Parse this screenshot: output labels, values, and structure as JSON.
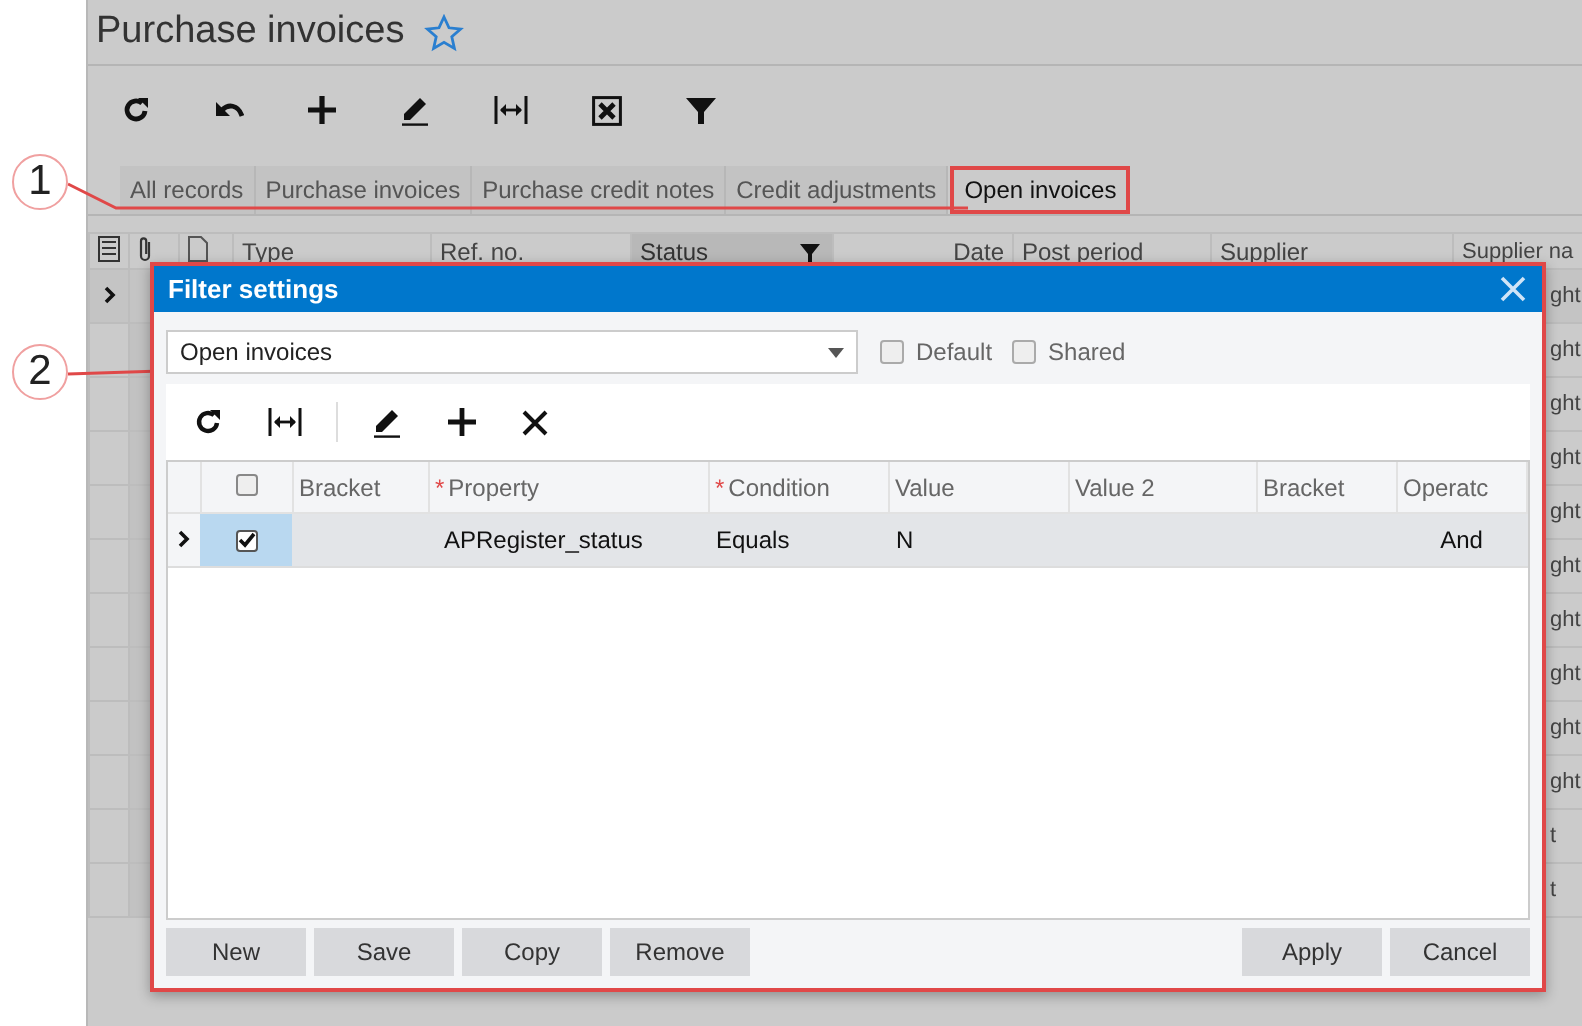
{
  "page": {
    "title": "Purchase invoices"
  },
  "tabs": [
    {
      "label": "All records",
      "selected": false
    },
    {
      "label": "Purchase invoices",
      "selected": false
    },
    {
      "label": "Purchase credit notes",
      "selected": false
    },
    {
      "label": "Credit adjustments",
      "selected": false
    },
    {
      "label": "Open invoices",
      "selected": true
    }
  ],
  "callouts": [
    {
      "number": "1"
    },
    {
      "number": "2"
    }
  ],
  "grid": {
    "columns": [
      {
        "label": "Type",
        "filtered": false
      },
      {
        "label": "Ref. no.",
        "filtered": false
      },
      {
        "label": "Status",
        "filtered": true
      },
      {
        "label": "Date",
        "filtered": false
      },
      {
        "label": "Post period",
        "filtered": false
      },
      {
        "label": "Supplier",
        "filtered": false
      },
      {
        "label": "Supplier na",
        "filtered": false
      }
    ],
    "rows": [
      {
        "current": true,
        "supplier_name": "ght"
      },
      {
        "current": false,
        "supplier_name": "ght"
      },
      {
        "current": false,
        "supplier_name": "ght"
      },
      {
        "current": false,
        "supplier_name": "ght"
      },
      {
        "current": false,
        "supplier_name": "ght"
      },
      {
        "current": false,
        "supplier_name": "ght"
      },
      {
        "current": false,
        "supplier_name": "ght"
      },
      {
        "current": false,
        "supplier_name": "ght"
      },
      {
        "current": false,
        "supplier_name": "ght"
      },
      {
        "current": false,
        "supplier_name": "ght"
      },
      {
        "current": false,
        "supplier_name": "t"
      },
      {
        "current": false,
        "supplier_name": "t"
      }
    ]
  },
  "dialog": {
    "title": "Filter settings",
    "filter_name": "Open invoices",
    "all_checked": false,
    "options": [
      {
        "label": "Default",
        "checked": false
      },
      {
        "label": "Shared",
        "checked": false
      }
    ],
    "columns": [
      {
        "label": "Bracket"
      },
      {
        "label": "Property",
        "required_marker": "*"
      },
      {
        "label": "Condition",
        "required_marker": "*"
      },
      {
        "label": "Value"
      },
      {
        "label": "Value 2"
      },
      {
        "label": "Bracket"
      },
      {
        "label": "Operatc"
      }
    ],
    "rows": [
      {
        "current": true,
        "checked": true,
        "property": "APRegister_status",
        "condition": "Equals",
        "value": "N",
        "operator": "And"
      }
    ],
    "buttons_left": [
      "New",
      "Save",
      "Copy",
      "Remove"
    ],
    "buttons_right": [
      "Apply",
      "Cancel"
    ]
  }
}
